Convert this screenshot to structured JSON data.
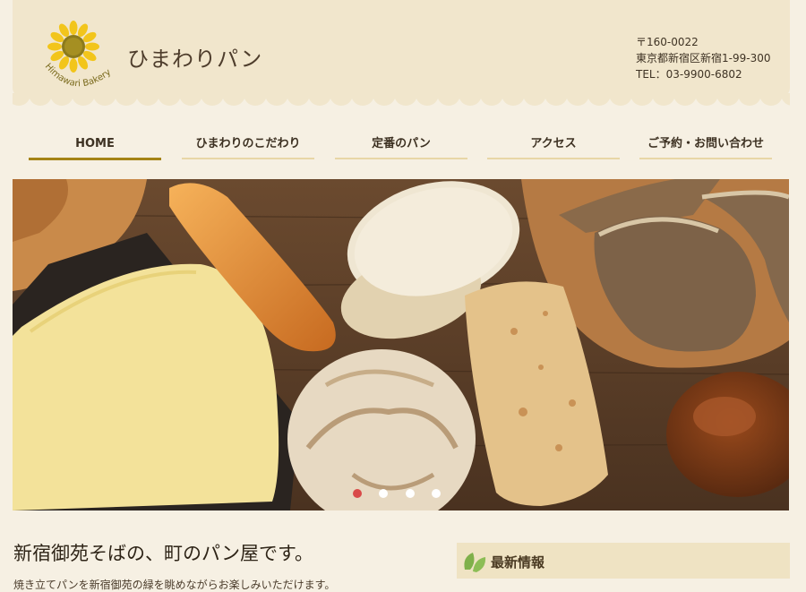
{
  "header": {
    "site_title": "ひまわりパン",
    "logo_text": "Himawari Bakery",
    "contact": {
      "postal": "〒160-0022",
      "address": "東京都新宿区新宿1-99-300",
      "tel": "TEL：03-9900-6802"
    }
  },
  "nav": {
    "items": [
      {
        "label": "HOME",
        "active": true
      },
      {
        "label": "ひまわりのこだわり",
        "active": false
      },
      {
        "label": "定番のパン",
        "active": false
      },
      {
        "label": "アクセス",
        "active": false
      },
      {
        "label": "ご予約・お問い合わせ",
        "active": false
      }
    ]
  },
  "carousel": {
    "slide_count": 4,
    "active_index": 0
  },
  "intro": {
    "heading": "新宿御苑そばの、町のパン屋です。",
    "text": "焼き立てパンを新宿御苑の緑を眺めながらお楽しみいただけます。"
  },
  "news": {
    "title": "最新情報"
  },
  "colors": {
    "header_bg": "#f1e6cc",
    "page_bg": "#f6f0e3",
    "nav_active_underline": "#a48316",
    "nav_underline": "#e8d6a6",
    "dot_active": "#d94a49",
    "leaf_green": "#7fb04a"
  },
  "icons": {
    "logo": "sunflower-icon",
    "news": "leaf-icon"
  }
}
